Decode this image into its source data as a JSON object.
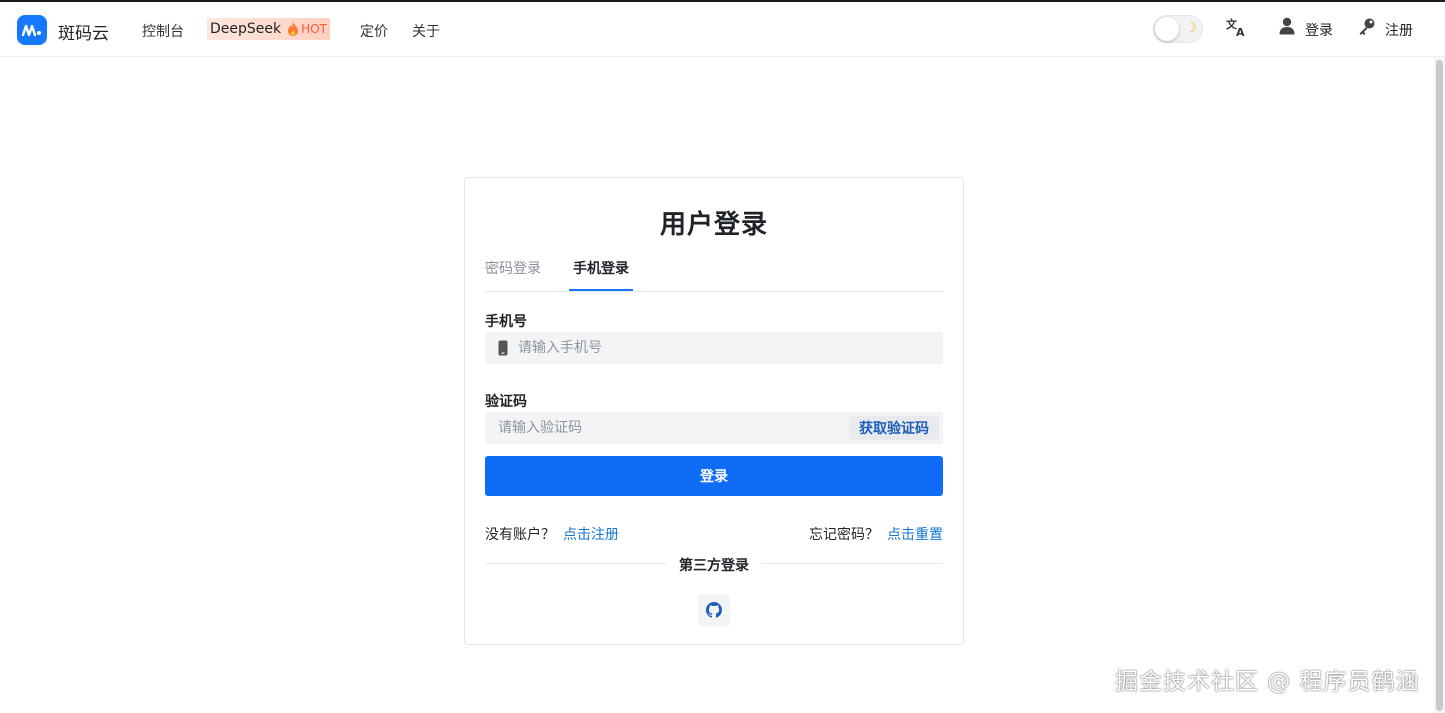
{
  "header": {
    "brand": "斑码云",
    "nav": [
      "控制台",
      "DeepSeek",
      "定价",
      "关于"
    ],
    "hot_badge": "HOT",
    "login_label": "登录",
    "register_label": "注册"
  },
  "login_card": {
    "title": "用户登录",
    "tabs": [
      {
        "label": "密码登录",
        "active": false
      },
      {
        "label": "手机登录",
        "active": true
      }
    ],
    "phone_label": "手机号",
    "phone_placeholder": "请输入手机号",
    "code_label": "验证码",
    "code_placeholder": "请输入验证码",
    "get_code_label": "获取验证码",
    "submit_label": "登录",
    "no_account_text": "没有账户？",
    "register_link": "点击注册",
    "forgot_text": "忘记密码？",
    "reset_link": "点击重置",
    "third_party_label": "第三方登录"
  },
  "watermark": "掘金技术社区 @ 程序员鹤涵",
  "colors": {
    "primary": "#0f6cf6",
    "link": "#1677d2",
    "hot": "#ff5a36",
    "brand_logo": "#1677ff"
  },
  "icons": [
    "brand-logo-icon",
    "fire-icon",
    "moon-icon",
    "translate-icon",
    "user-icon",
    "key-icon",
    "phone-icon",
    "github-icon"
  ]
}
